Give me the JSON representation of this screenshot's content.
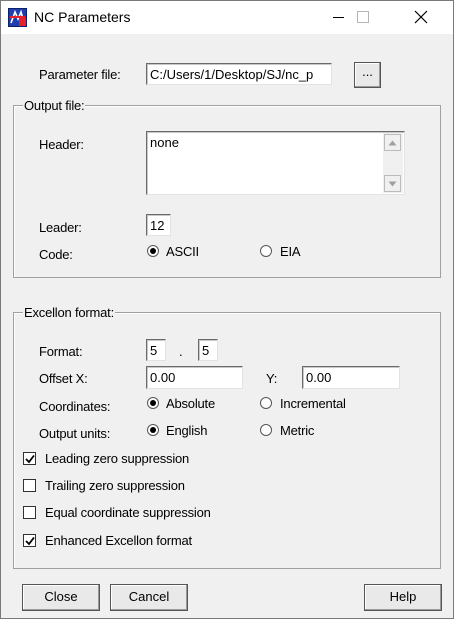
{
  "window": {
    "title": "NC Parameters"
  },
  "parameter_file": {
    "label": "Parameter file:",
    "value": "C:/Users/1/Desktop/SJ/nc_p",
    "browse_label": "..."
  },
  "output_file": {
    "group_title": "Output file:",
    "header_label": "Header:",
    "header_value": "none",
    "leader_label": "Leader:",
    "leader_value": "12",
    "code_label": "Code:",
    "code_options": [
      "ASCII",
      "EIA"
    ],
    "code_selected": "ASCII"
  },
  "excellon": {
    "group_title": "Excellon format:",
    "format_label": "Format:",
    "format_int": "5",
    "format_sep": ".",
    "format_dec": "5",
    "offset_x_label": "Offset X:",
    "offset_x_value": "0.00",
    "offset_y_label": "Y:",
    "offset_y_value": "0.00",
    "coordinates_label": "Coordinates:",
    "coordinates_options": [
      "Absolute",
      "Incremental"
    ],
    "coordinates_selected": "Absolute",
    "units_label": "Output units:",
    "units_options": [
      "English",
      "Metric"
    ],
    "units_selected": "English",
    "checkboxes": [
      {
        "label": "Leading zero suppression",
        "checked": true
      },
      {
        "label": "Trailing zero suppression",
        "checked": false
      },
      {
        "label": "Equal coordinate suppression",
        "checked": false
      },
      {
        "label": "Enhanced Excellon format",
        "checked": true
      }
    ]
  },
  "buttons": {
    "close": "Close",
    "cancel": "Cancel",
    "help": "Help"
  }
}
